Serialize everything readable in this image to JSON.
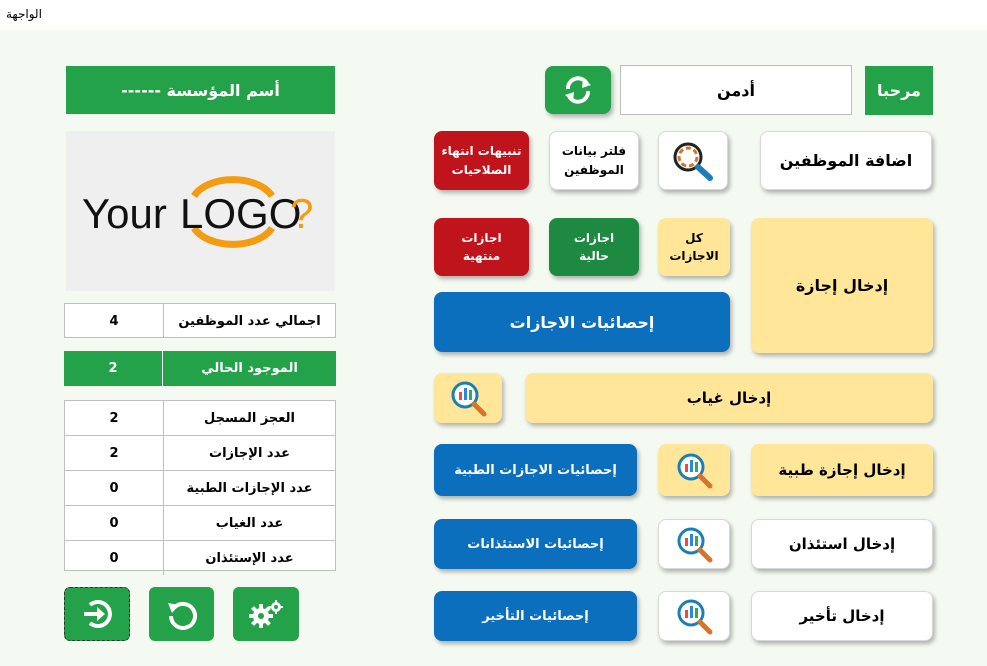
{
  "window": {
    "title": "الواجهة"
  },
  "header": {
    "welcome_label": "مرحبا",
    "user_name": "أدمن",
    "org_name": "أسم المؤسسة ------"
  },
  "logo": {
    "text_your": "Your",
    "text_logo": "LOGO",
    "text_q": "?"
  },
  "buttons": {
    "add_employees": "اضافة الموظفين",
    "filter_employees": "فلتر بيانات الموظفين",
    "expiry_alerts": "تنبيهات انتهاء الصلاحيات",
    "enter_leave": "إدخال إجازة",
    "all_leaves": "كل الاجازات",
    "current_leaves": "اجازات حالية",
    "ended_leaves": "اجازات منتهية",
    "leave_stats": "إحصائيات الاجازات",
    "enter_absence": "إدخال غياب",
    "enter_medical_leave": "إدخال إجازة طبية",
    "medical_leave_stats": "إحصائيات الاجازات الطبية",
    "enter_permission": "إدخال استئذان",
    "permission_stats": "إحصائيات الاستئذانات",
    "enter_delay": "إدخال تأخير",
    "delay_stats": "إحصائيات التأخير"
  },
  "stats": {
    "total_employees": {
      "label": "اجمالي عدد الموظفين",
      "value": "4"
    },
    "present": {
      "label": "الموجود الحالي",
      "value": "2"
    },
    "rows": [
      {
        "label": "العجز المسجل",
        "value": "2"
      },
      {
        "label": "عدد الإجازات",
        "value": "2"
      },
      {
        "label": "عدد الإجازات الطبية",
        "value": "0"
      },
      {
        "label": "عدد الغياب",
        "value": "0"
      },
      {
        "label": "عدد الإستئذان",
        "value": "0"
      }
    ]
  },
  "colors": {
    "green": "#24a24a",
    "blue": "#0b6fbd",
    "yellow": "#ffe699",
    "red": "#c0141c"
  }
}
